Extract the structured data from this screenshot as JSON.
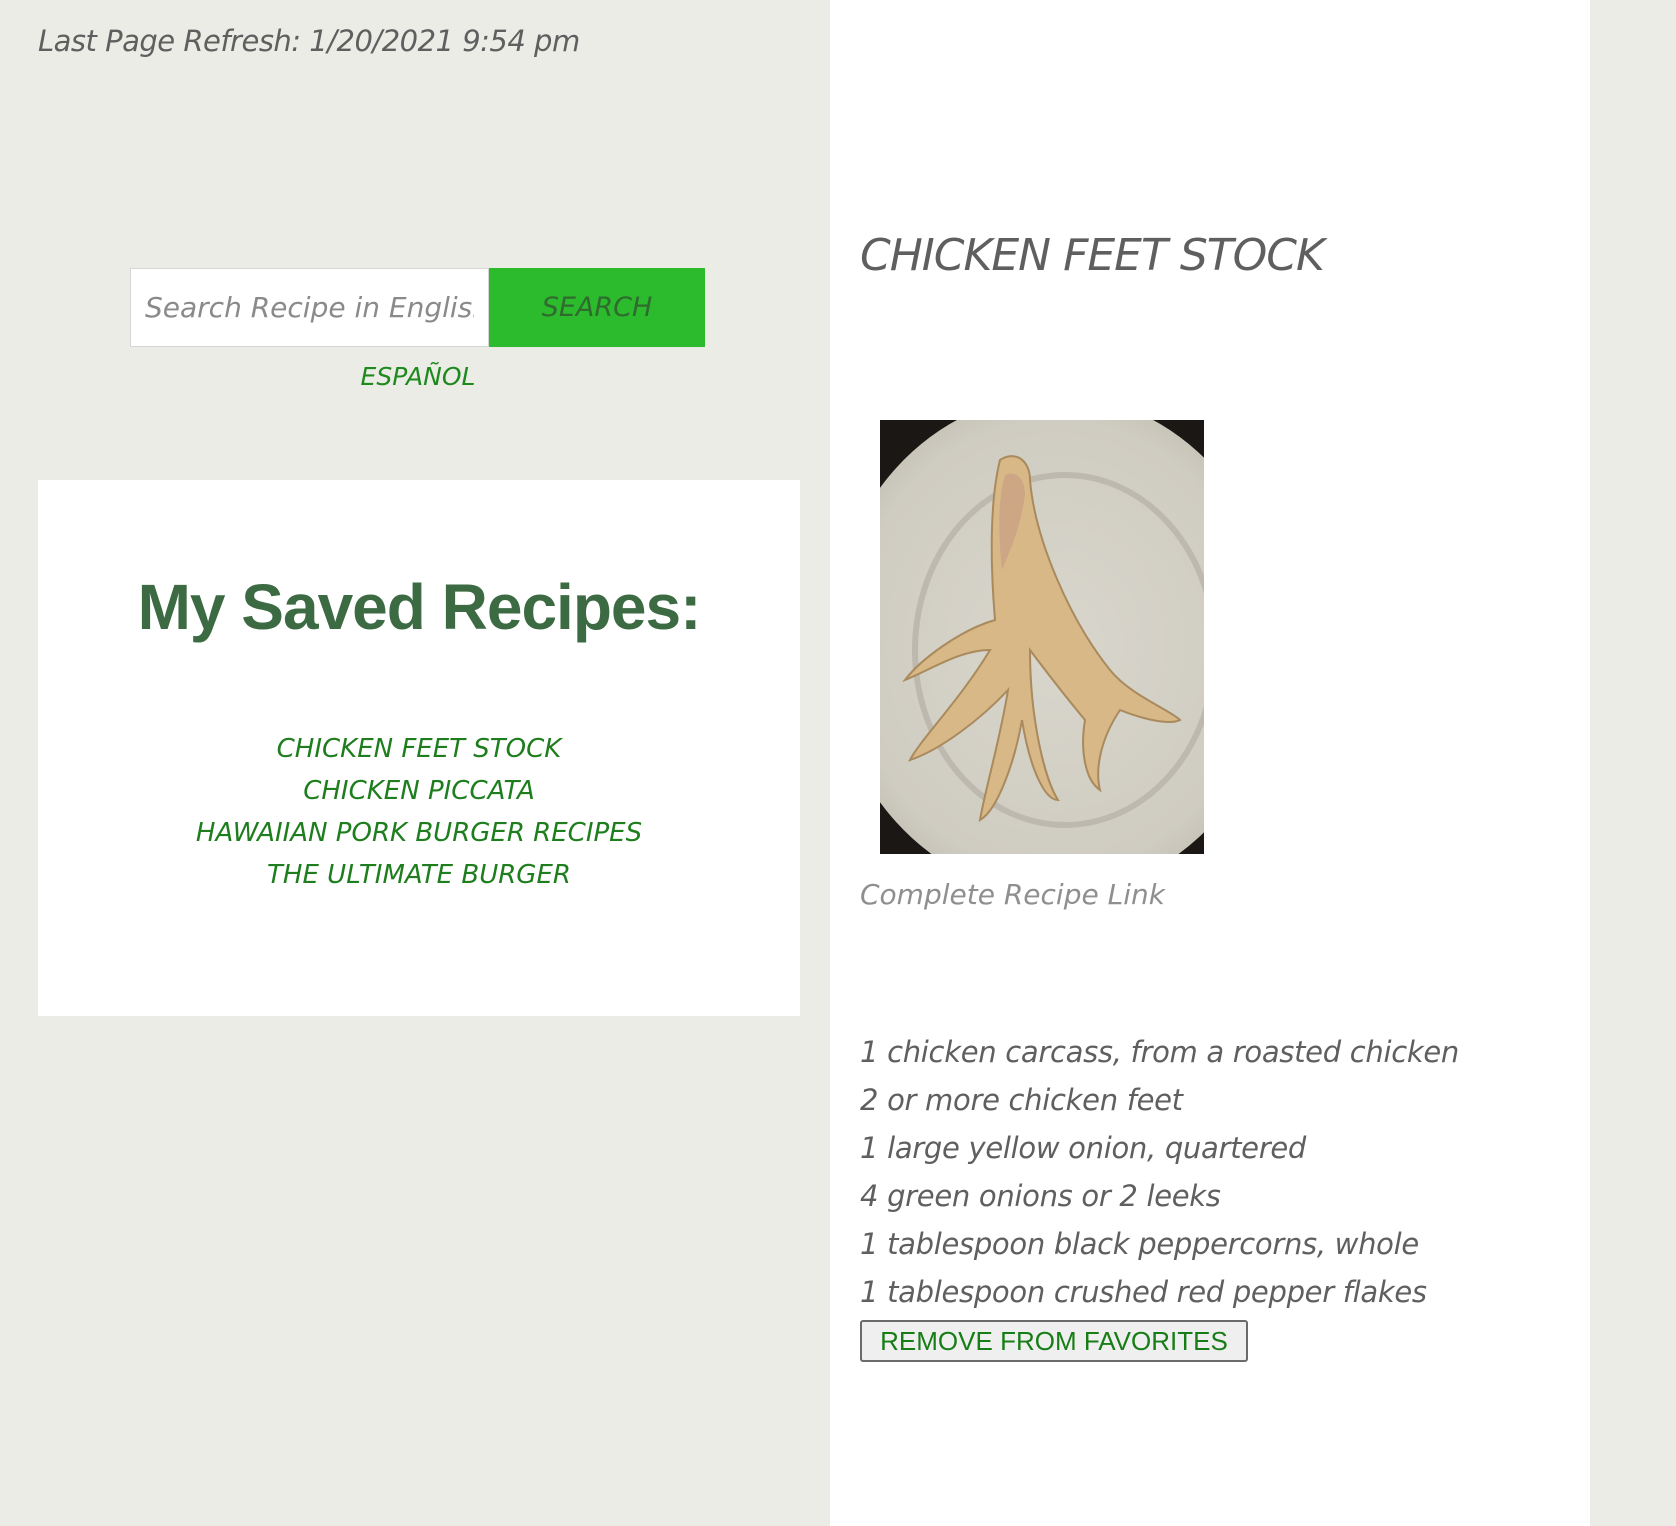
{
  "header": {
    "last_refresh": "Last Page Refresh: 1/20/2021 9:54 pm"
  },
  "search": {
    "placeholder": "Search Recipe in English...",
    "button_label": "SEARCH",
    "language_link": "ESPAÑOL"
  },
  "saved": {
    "title": "My Saved Recipes:",
    "items": [
      "CHICKEN FEET STOCK",
      "CHICKEN PICCATA",
      "HAWAIIAN PORK BURGER RECIPES",
      "THE ULTIMATE BURGER"
    ]
  },
  "recipe": {
    "title": "CHICKEN FEET STOCK",
    "image_alt": "chicken feet on a plate",
    "link_label": "Complete Recipe Link",
    "ingredients": [
      "1 chicken carcass, from a roasted chicken",
      "2 or more chicken feet",
      "1 large yellow onion, quartered",
      "4 green onions or 2 leeks",
      "1 tablespoon black peppercorns, whole",
      "1 tablespoon crushed red pepper flakes"
    ],
    "remove_label": "REMOVE FROM FAVORITES"
  },
  "colors": {
    "page_bg": "#ecece7",
    "accent_green": "#2cbb2c",
    "link_green": "#1e7e1e",
    "heading_green": "#3c6a42",
    "text_gray": "#5f5f5f"
  }
}
